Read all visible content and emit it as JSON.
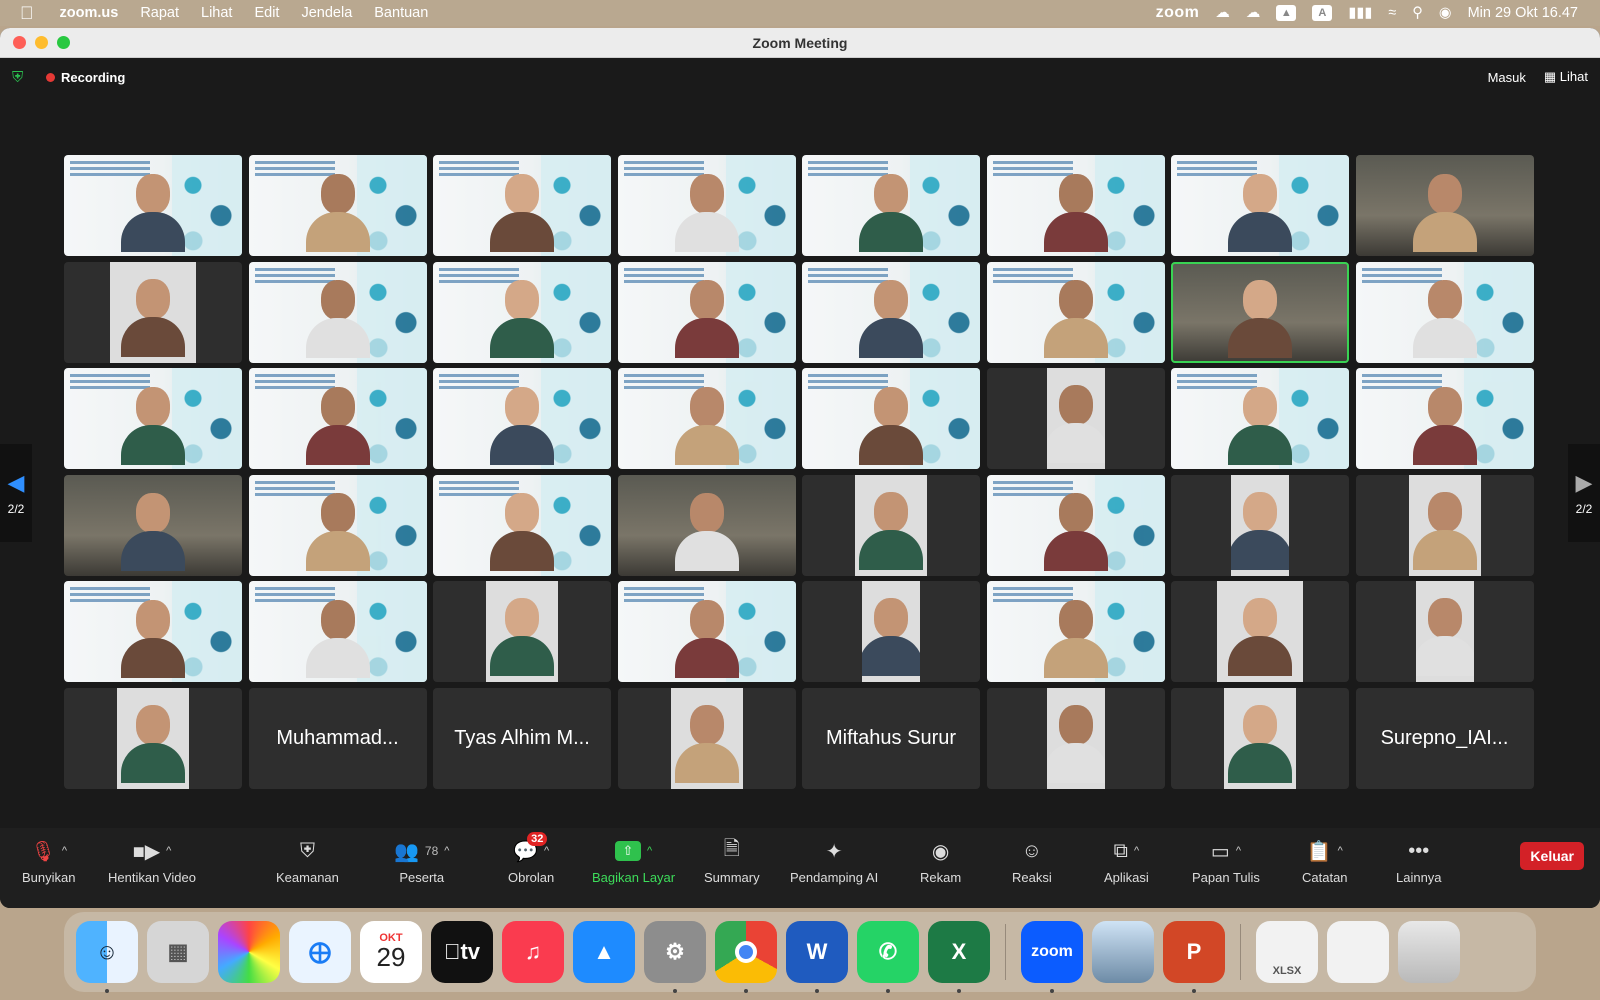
{
  "menubar": {
    "app_name": "zoom.us",
    "items": [
      "Rapat",
      "Lihat",
      "Edit",
      "Jendela",
      "Bantuan"
    ],
    "zoom_label": "zoom",
    "keyboard_label": "A",
    "datetime": "Min 29 Okt  16.47"
  },
  "window": {
    "title": "Zoom Meeting"
  },
  "meeting": {
    "recording_label": "Recording",
    "sign_in_label": "Masuk",
    "view_label": "Lihat",
    "page_indicator_left": "2/2",
    "page_indicator_right": "2/2",
    "tiles": [
      {
        "kind": "slide"
      },
      {
        "kind": "slide"
      },
      {
        "kind": "slide"
      },
      {
        "kind": "slide"
      },
      {
        "kind": "slide"
      },
      {
        "kind": "slide"
      },
      {
        "kind": "slide"
      },
      {
        "kind": "room"
      },
      {
        "kind": "portrait"
      },
      {
        "kind": "slide"
      },
      {
        "kind": "slide"
      },
      {
        "kind": "slide"
      },
      {
        "kind": "slide"
      },
      {
        "kind": "slide"
      },
      {
        "kind": "room",
        "active": true
      },
      {
        "kind": "slide"
      },
      {
        "kind": "slide"
      },
      {
        "kind": "slide"
      },
      {
        "kind": "slide"
      },
      {
        "kind": "slide"
      },
      {
        "kind": "slide"
      },
      {
        "kind": "portrait"
      },
      {
        "kind": "slide"
      },
      {
        "kind": "slide"
      },
      {
        "kind": "room"
      },
      {
        "kind": "slide"
      },
      {
        "kind": "slide"
      },
      {
        "kind": "room"
      },
      {
        "kind": "portrait"
      },
      {
        "kind": "slide"
      },
      {
        "kind": "portrait"
      },
      {
        "kind": "portrait"
      },
      {
        "kind": "slide"
      },
      {
        "kind": "slide"
      },
      {
        "kind": "portrait"
      },
      {
        "kind": "slide"
      },
      {
        "kind": "portrait"
      },
      {
        "kind": "slide"
      },
      {
        "kind": "portrait"
      },
      {
        "kind": "portrait"
      },
      {
        "kind": "portrait"
      },
      {
        "kind": "name",
        "name": "Muhammad..."
      },
      {
        "kind": "name",
        "name": "Tyas Alhim M..."
      },
      {
        "kind": "portrait"
      },
      {
        "kind": "name",
        "name": "Miftahus Surur"
      },
      {
        "kind": "portrait"
      },
      {
        "kind": "portrait"
      },
      {
        "kind": "name",
        "name": "Surepno_IAI..."
      }
    ]
  },
  "toolbar": {
    "unmute": "Bunyikan",
    "stop_video": "Hentikan Video",
    "security": "Keamanan",
    "participants": "Peserta",
    "participants_count": "78",
    "chat": "Obrolan",
    "chat_badge": "32",
    "share": "Bagikan Layar",
    "summary": "Summary",
    "ai": "Pendamping AI",
    "record": "Rekam",
    "reactions": "Reaksi",
    "apps": "Aplikasi",
    "whiteboard": "Papan Tulis",
    "notes": "Catatan",
    "more": "Lainnya",
    "leave": "Keluar"
  },
  "dock": {
    "calendar_month": "OKT",
    "calendar_day": "29",
    "tv_label": "tv",
    "zoom_label": "zoom",
    "word_label": "W",
    "excel_label": "X",
    "ppt_label": "P",
    "file_label": "XLSX"
  },
  "colors": {
    "accent_green": "#3ddc5a",
    "leave_red": "#d32127",
    "active_outline": "#39d353"
  }
}
